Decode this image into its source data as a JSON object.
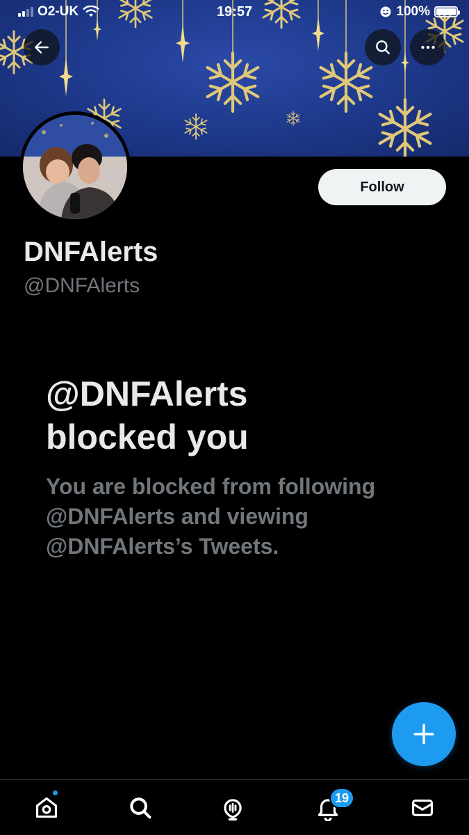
{
  "status_bar": {
    "carrier": "O2-UK",
    "time": "19:57",
    "battery": "100%"
  },
  "profile": {
    "display_name": "DNFAlerts",
    "handle": "@DNFAlerts",
    "follow_label": "Follow"
  },
  "blocked": {
    "title_line1": "@DNFAlerts",
    "title_line2": "blocked you",
    "body_line1": "You are blocked from following",
    "body_line2": "@DNFAlerts and viewing",
    "body_line3": "@DNFAlerts’s Tweets."
  },
  "tab_bar": {
    "notifications_count": "19"
  },
  "colors": {
    "accent": "#1d9bf0",
    "banner": "#1d3889",
    "ornament": "#e0c878",
    "muted_text": "#71767b"
  },
  "icons": {
    "back": "arrow-left-icon",
    "search": "search-icon",
    "more": "more-horizontal-icon",
    "fab": "plus-icon",
    "home": "home-icon",
    "tab_search": "search-icon",
    "spaces": "microphone-icon",
    "notifications": "bell-icon",
    "messages": "envelope-icon"
  }
}
